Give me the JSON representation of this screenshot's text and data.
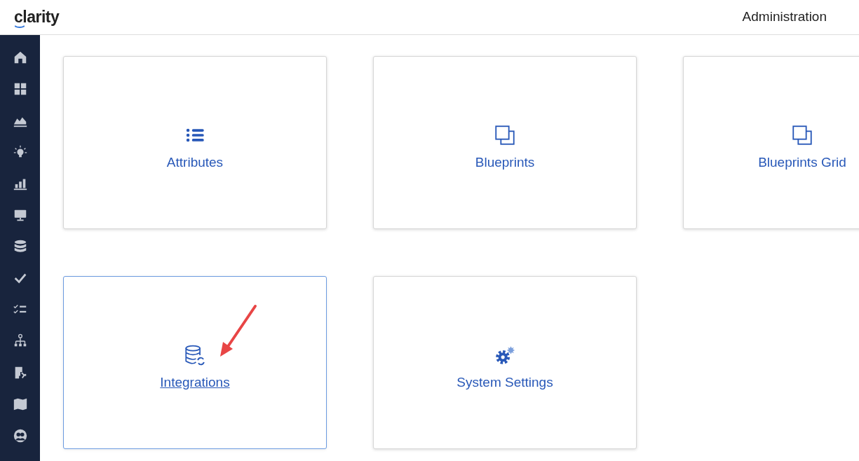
{
  "header": {
    "logo": "clarity",
    "title": "Administration"
  },
  "cards": [
    {
      "label": "Attributes",
      "kind": "list",
      "hovered": false
    },
    {
      "label": "Blueprints",
      "kind": "copy",
      "hovered": false
    },
    {
      "label": "Blueprints Grid",
      "kind": "copy",
      "hovered": false
    },
    {
      "label": "Integrations",
      "kind": "database-sync",
      "hovered": true
    },
    {
      "label": "System Settings",
      "kind": "gears",
      "hovered": false
    }
  ]
}
